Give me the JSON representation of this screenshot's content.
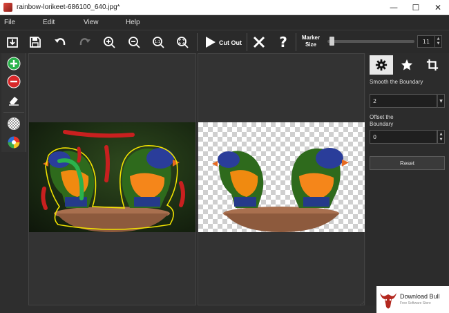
{
  "window": {
    "title": "rainbow-lorikeet-686100_640.jpg*",
    "minimize_glyph": "—",
    "maximize_glyph": "☐",
    "close_glyph": "✕"
  },
  "menu": [
    {
      "label": "File"
    },
    {
      "label": "Edit"
    },
    {
      "label": "View"
    },
    {
      "label": "Help"
    }
  ],
  "toolbar": {
    "buttons": [
      {
        "name": "open-icon"
      },
      {
        "name": "save-icon"
      },
      {
        "name": "undo-icon"
      },
      {
        "name": "redo-icon"
      },
      {
        "name": "zoom-in-icon"
      },
      {
        "name": "zoom-out-icon"
      },
      {
        "name": "actual-size-icon"
      },
      {
        "name": "fit-to-window-icon"
      }
    ],
    "cutout_label": "Cut Out",
    "cancel_glyph": "✕",
    "help_glyph": "?",
    "marker_size_label": "Marker Size",
    "marker_size_value": "11",
    "marker_size_level": 0.05
  },
  "left_tools": [
    {
      "name": "keep-marker-icon",
      "color": "#2bb24c"
    },
    {
      "name": "remove-marker-icon",
      "color": "#d8282a"
    },
    {
      "name": "eraser-icon"
    },
    {
      "name": "transparency-icon"
    },
    {
      "name": "background-color-icon"
    }
  ],
  "right_panel": {
    "tabs": [
      {
        "name": "settings-tab",
        "icon": "gear-icon",
        "active": true
      },
      {
        "name": "effects-tab",
        "icon": "star-icon",
        "active": false
      },
      {
        "name": "crop-tab",
        "icon": "crop-icon",
        "active": false
      }
    ],
    "smooth_label": "Smooth the Boundary",
    "smooth_value": "2",
    "offset_label": "Offset the Boundary",
    "offset_value": "0",
    "reset_label": "Reset"
  },
  "watermark": {
    "title": "Download Bull",
    "subtitle": "Free Software Store"
  },
  "colors": {
    "keep_marker": "#2bb24c",
    "remove_marker": "#c8201f",
    "boundary": "#f2e400"
  }
}
